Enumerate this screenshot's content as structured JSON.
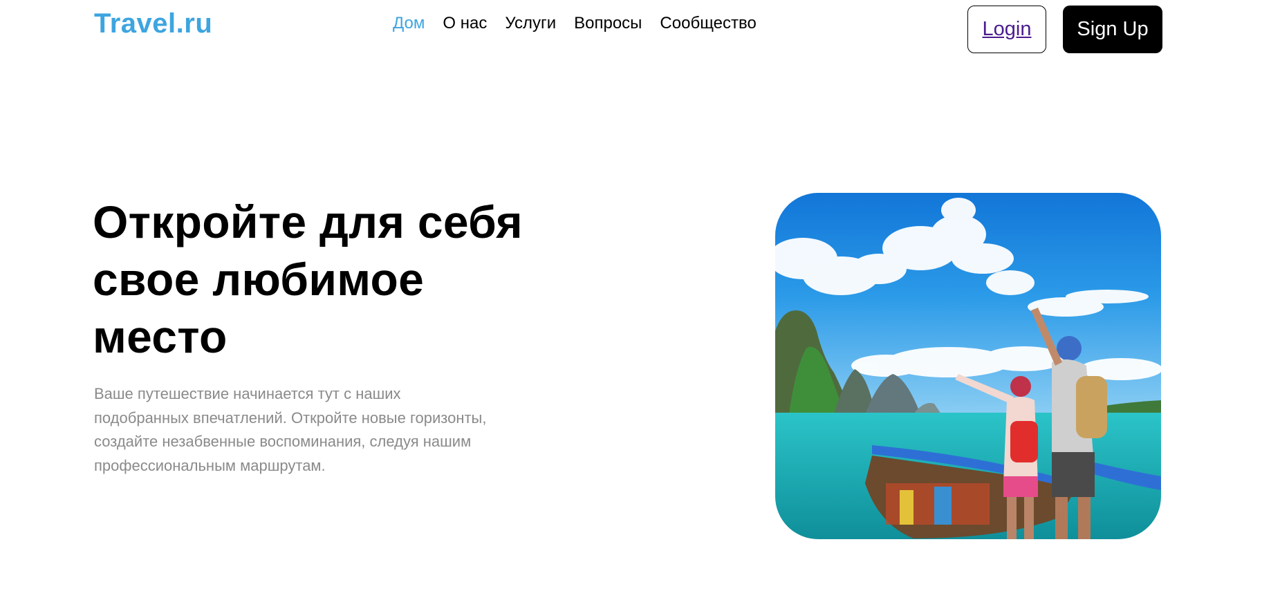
{
  "header": {
    "logo": "Travel.ru",
    "nav": [
      {
        "label": "Дом",
        "active": true
      },
      {
        "label": "О нас",
        "active": false
      },
      {
        "label": "Услуги",
        "active": false
      },
      {
        "label": "Вопросы",
        "active": false
      },
      {
        "label": "Сообщество",
        "active": false
      }
    ],
    "login_label": "Login",
    "signup_label": "Sign Up"
  },
  "hero": {
    "title_lines": [
      "Откройте для себя",
      "свое любимое",
      "место"
    ],
    "text_lines": [
      "Ваше путешествие начинается тут с наших",
      "подобранных впечатлений. Откройте новые горизонты,",
      "создайте незабвенные воспоминания, следуя нашим",
      "профессиональным маршрутам."
    ]
  },
  "colors": {
    "logo": "#3da5e0",
    "nav_active": "#3da5e0",
    "text": "#000000",
    "muted_text": "#8a8a8a",
    "login_text": "#4b1c8e",
    "signup_bg": "#000000",
    "signup_text": "#ffffff"
  }
}
